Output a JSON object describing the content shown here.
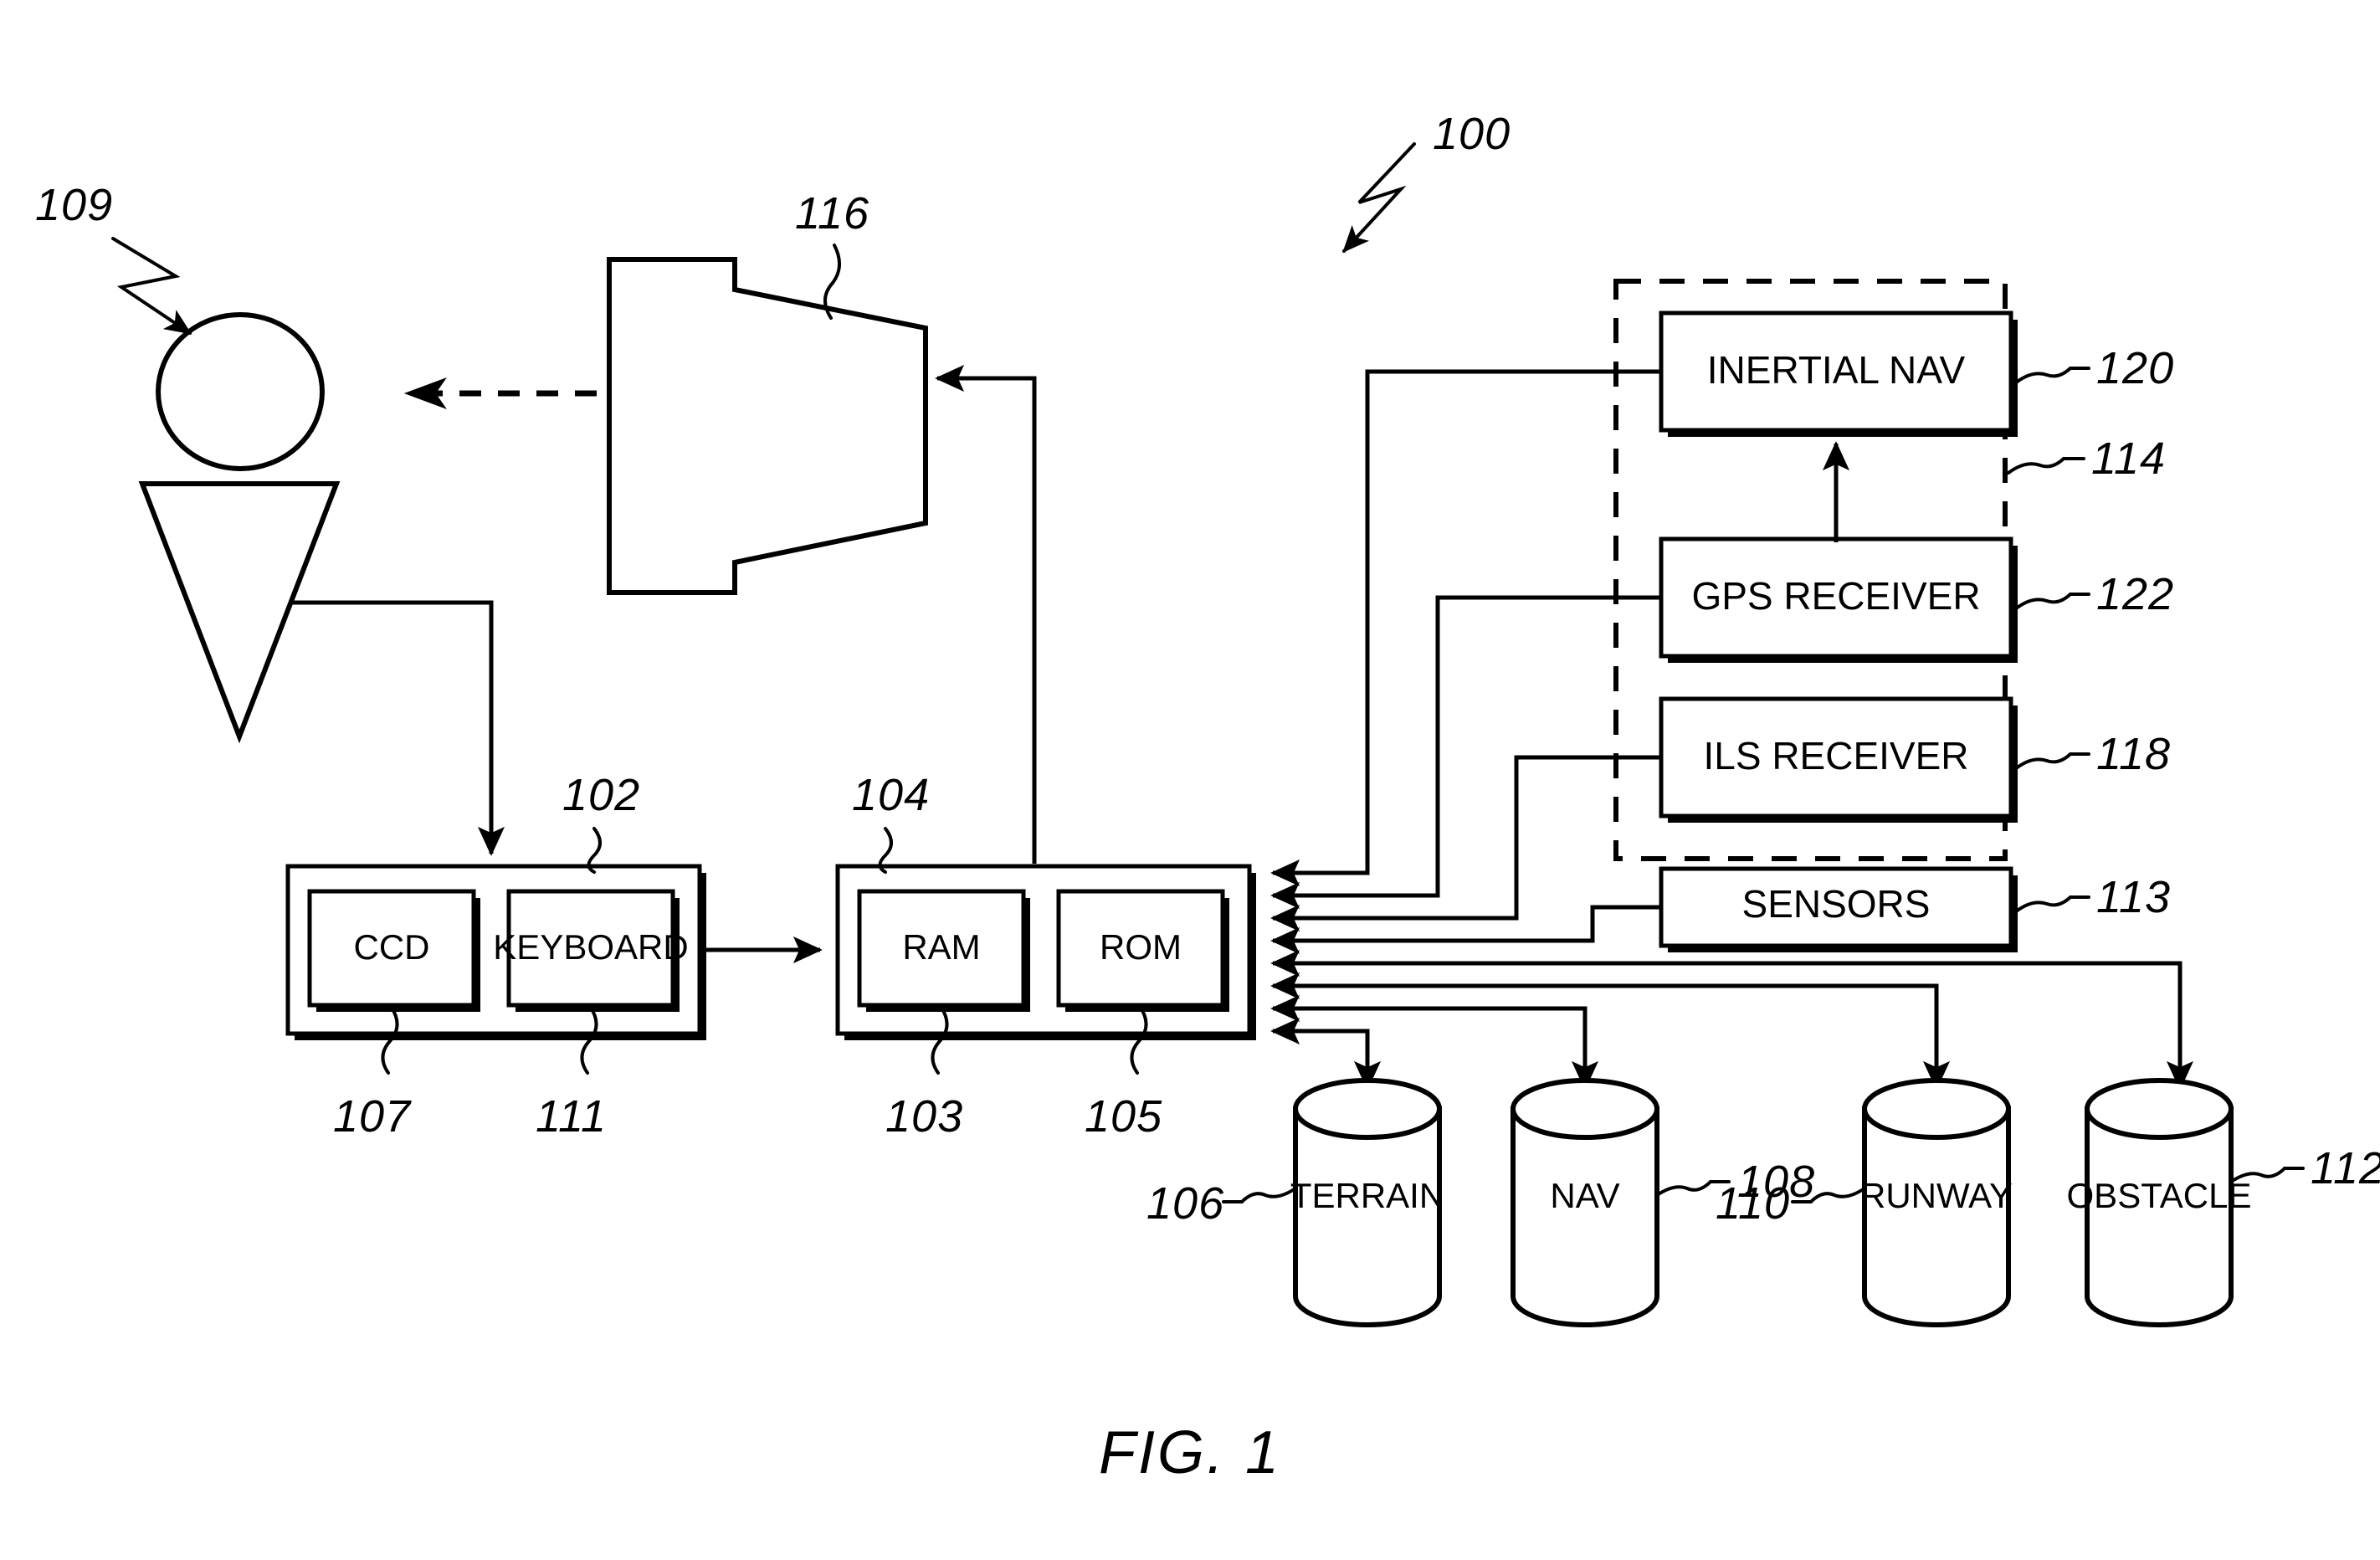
{
  "figure": {
    "caption": "FIG. 1",
    "system_ref": "100"
  },
  "pilot": {
    "ref": "109",
    "name": "pilot-operator-figure"
  },
  "display": {
    "ref": "116",
    "name": "display-unit"
  },
  "input_unit": {
    "ref": "102",
    "children": [
      {
        "label": "CCD",
        "ref": "107"
      },
      {
        "label": "KEYBOARD",
        "ref": "111"
      }
    ]
  },
  "processor_unit": {
    "ref": "104",
    "children": [
      {
        "label": "RAM",
        "ref": "103"
      },
      {
        "label": "ROM",
        "ref": "105"
      }
    ]
  },
  "nav_group": {
    "ref": "114",
    "boxes": [
      {
        "label": "INERTIAL NAV",
        "ref": "120"
      },
      {
        "label": "GPS RECEIVER",
        "ref": "122"
      },
      {
        "label": "ILS RECEIVER",
        "ref": "118"
      }
    ]
  },
  "sensors": {
    "label": "SENSORS",
    "ref": "113"
  },
  "databases": [
    {
      "label": "TERRAIN",
      "ref": "106"
    },
    {
      "label": "NAV",
      "ref": "108"
    },
    {
      "label": "RUNWAY",
      "ref": "110"
    },
    {
      "label": "OBSTACLE",
      "ref": "112"
    }
  ],
  "colors": {
    "ink": "#000000",
    "paper": "#ffffff"
  }
}
